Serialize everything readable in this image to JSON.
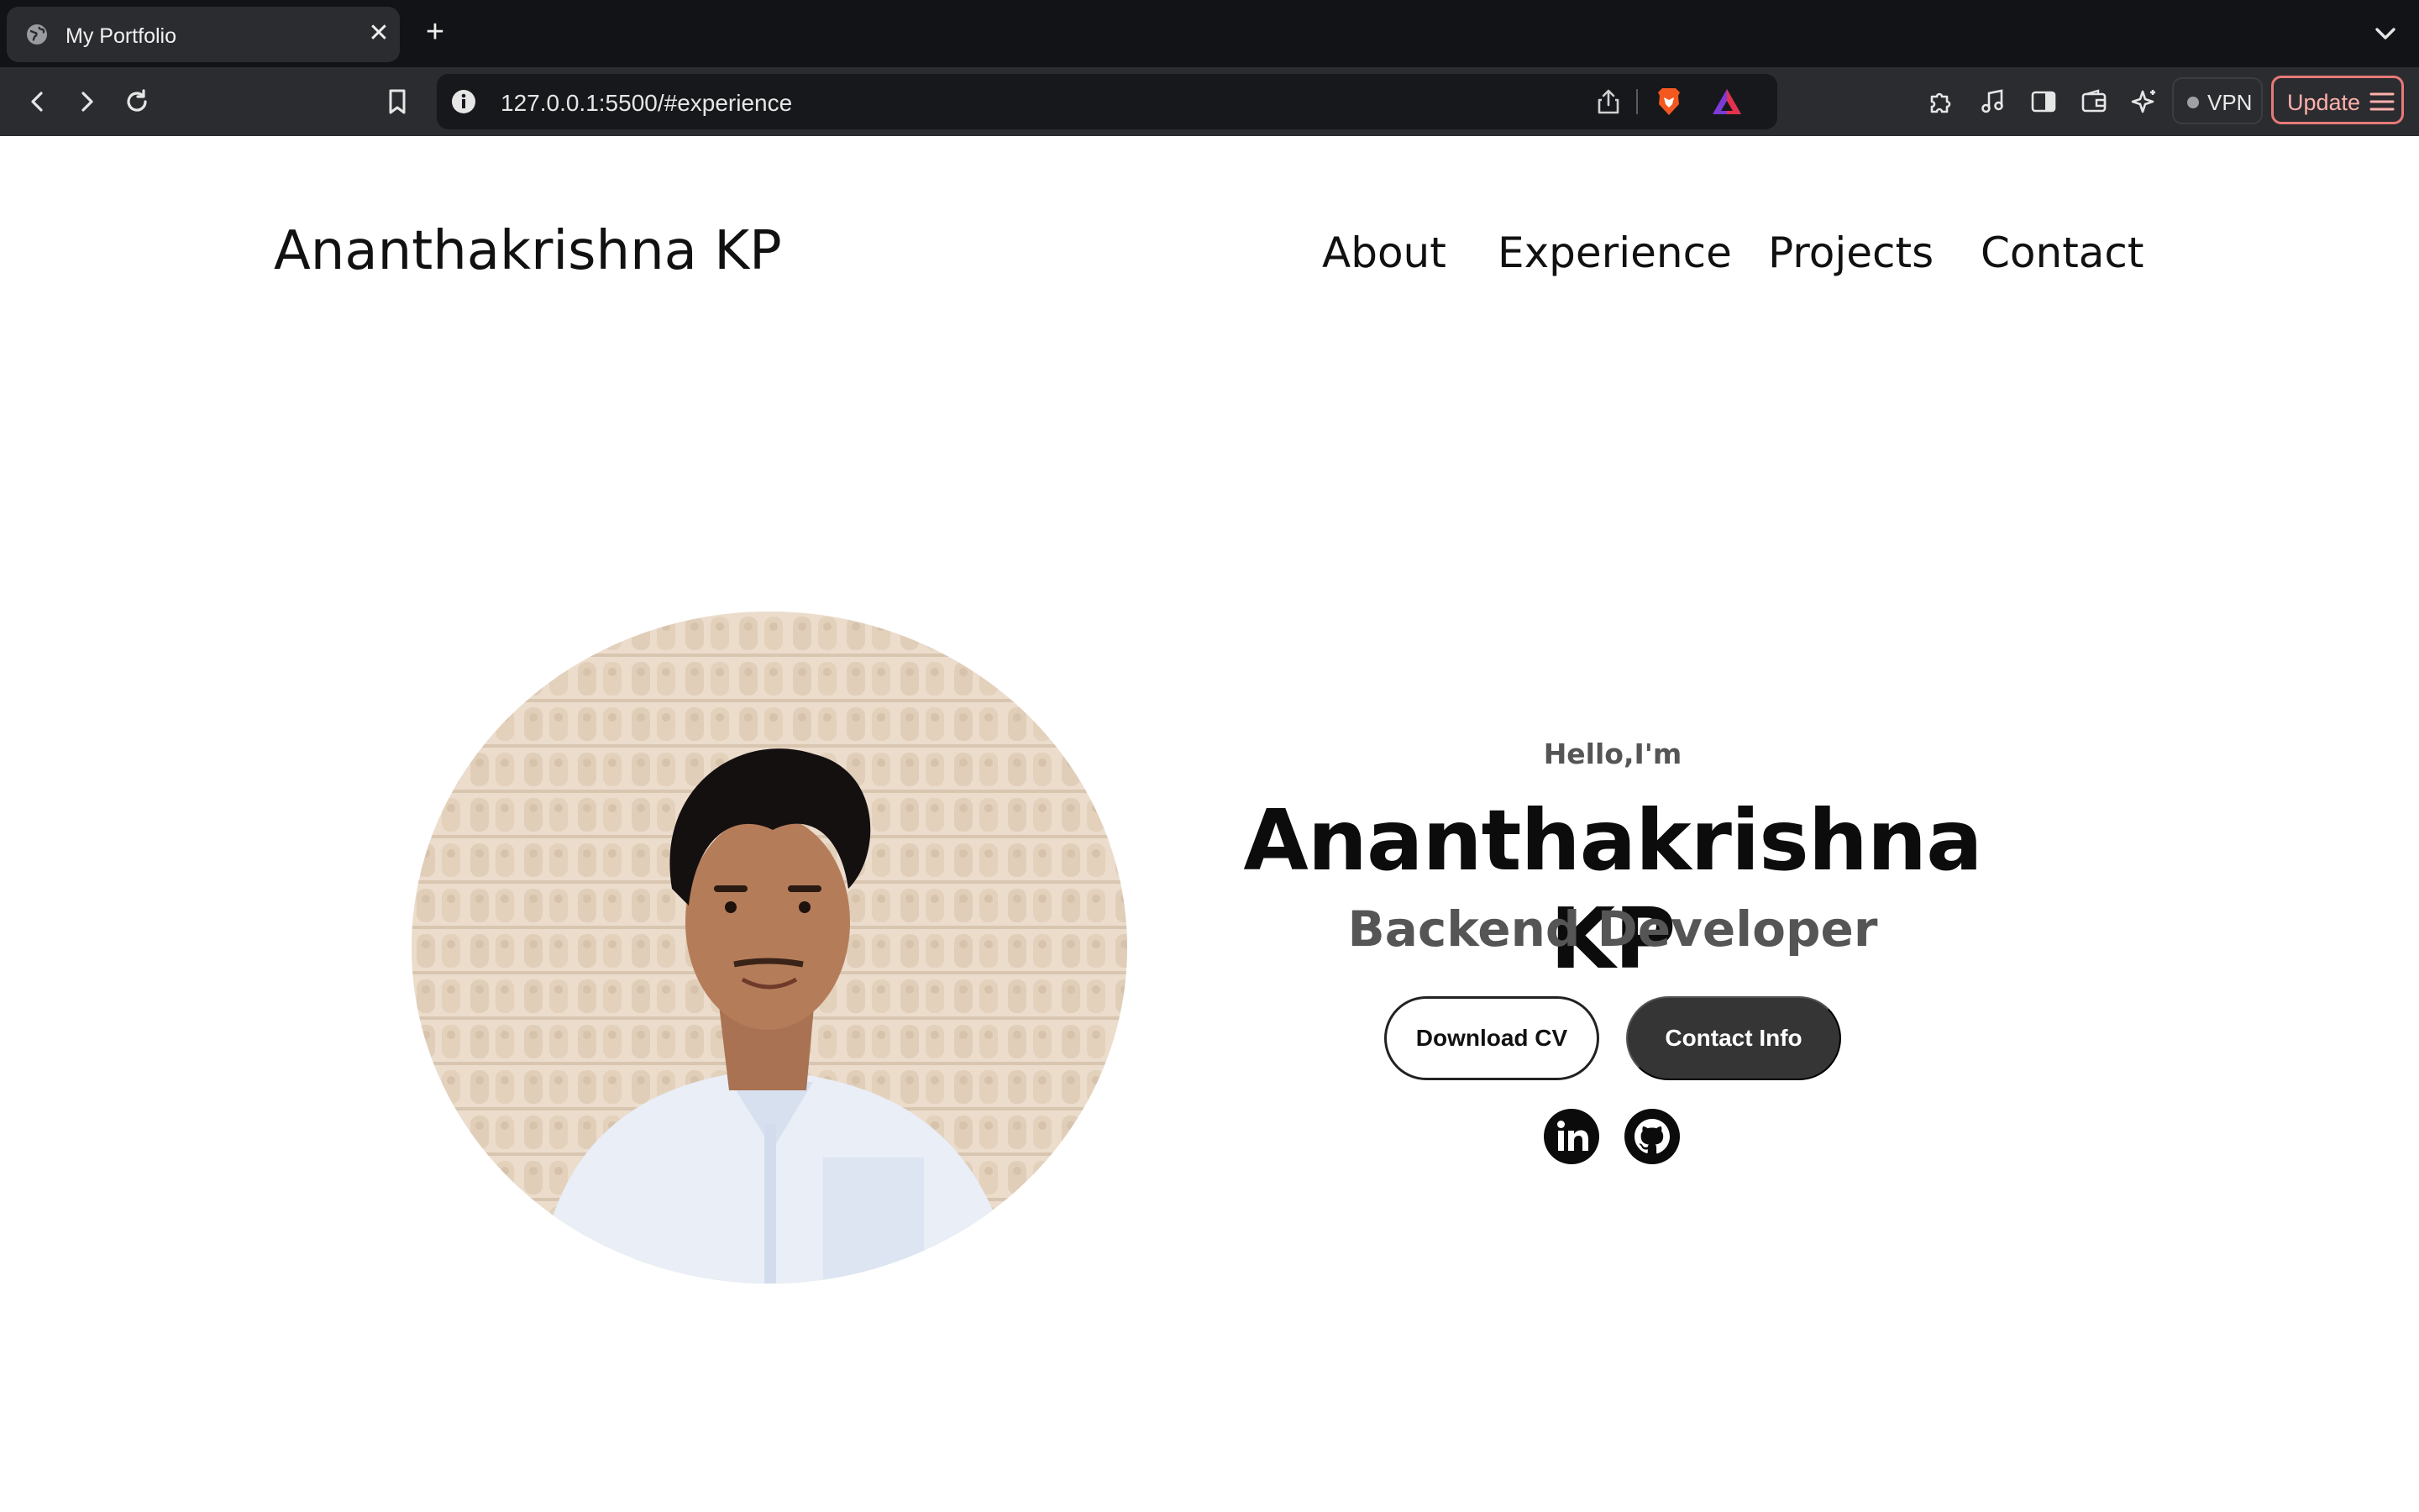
{
  "browser": {
    "tab": {
      "title": "My Portfolio"
    },
    "new_tab": "+",
    "close": "✕",
    "url": "127.0.0.1:5500/#experience",
    "vpn_label": "VPN",
    "update_label": "Update"
  },
  "header": {
    "logo": "Ananthakrishna KP",
    "nav": [
      "About",
      "Experience",
      "Projects",
      "Contact"
    ]
  },
  "hero": {
    "greeting": "Hello,I'm",
    "name": "Ananthakrishna KP",
    "role": "Backend Developer",
    "buttons": {
      "download_cv": "Download CV",
      "contact_info": "Contact Info"
    },
    "social": [
      "linkedin-icon",
      "github-icon"
    ]
  },
  "colors": {
    "chrome_dark": "#121316",
    "toolbar": "#2b2c30",
    "text_dark": "#111111",
    "subtitle_gray": "#555555",
    "button_dark": "#353535",
    "update_accent": "#e77a78"
  }
}
